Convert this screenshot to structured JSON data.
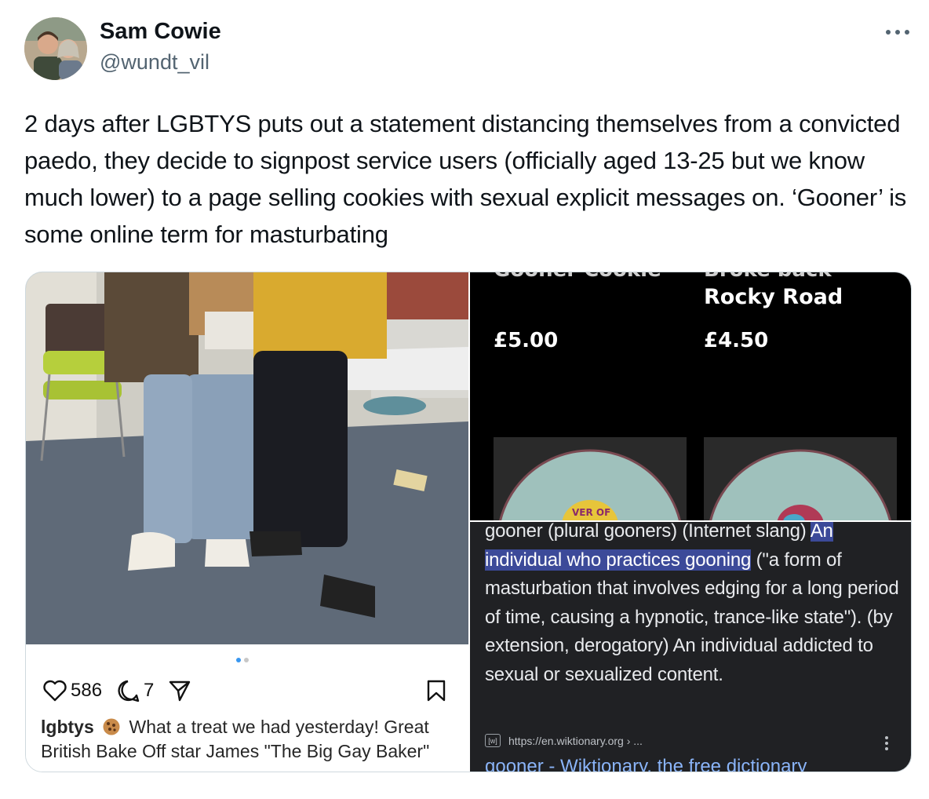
{
  "tweet": {
    "author_name": "Sam Cowie",
    "author_handle": "@wundt_vil",
    "more_label": "•••",
    "text": "2 days after LGBTYS puts out a statement distancing themselves from a convicted paedo, they decide to signpost service users (officially aged 13-25 but we know much lower) to a page selling cookies with sexual explicit messages on. ‘Gooner’ is some online term for masturbating"
  },
  "instagram": {
    "likes": "586",
    "comments": "7",
    "username": "lgbtys",
    "caption": "What a treat we had yesterday! Great British Bake Off star James \"The Big Gay Baker\"",
    "carousel_dots": 2,
    "icons": [
      "heart-icon",
      "comment-icon",
      "share-icon",
      "bookmark-icon",
      "cookie-emoji-icon"
    ]
  },
  "shop": {
    "product1_name_partial": "Gooner Cookie",
    "product1_price": "£5.00",
    "product2_name_partial": "Broke back",
    "product2_name": "Rocky Road",
    "product2_price": "£4.50"
  },
  "wiktionary": {
    "definition_pre": "gooner (plural gooners) (Internet slang) ",
    "definition_highlight": "An individual who practices gooning",
    "definition_post": " (\"a form of masturbation that involves edging for a long period of time, causing a hypnotic, trance-like state\"). (by extension, derogatory) An individual addicted to sexual or sexualized content.",
    "source_icon": "[w]",
    "source_url": "https://en.wiktionary.org › ...",
    "link_title": "gooner - Wiktionary, the free dictionary"
  },
  "colors": {
    "text": "#0f1419",
    "secondary": "#536471",
    "highlight": "#3c4a99",
    "link": "#8ab4f8"
  }
}
